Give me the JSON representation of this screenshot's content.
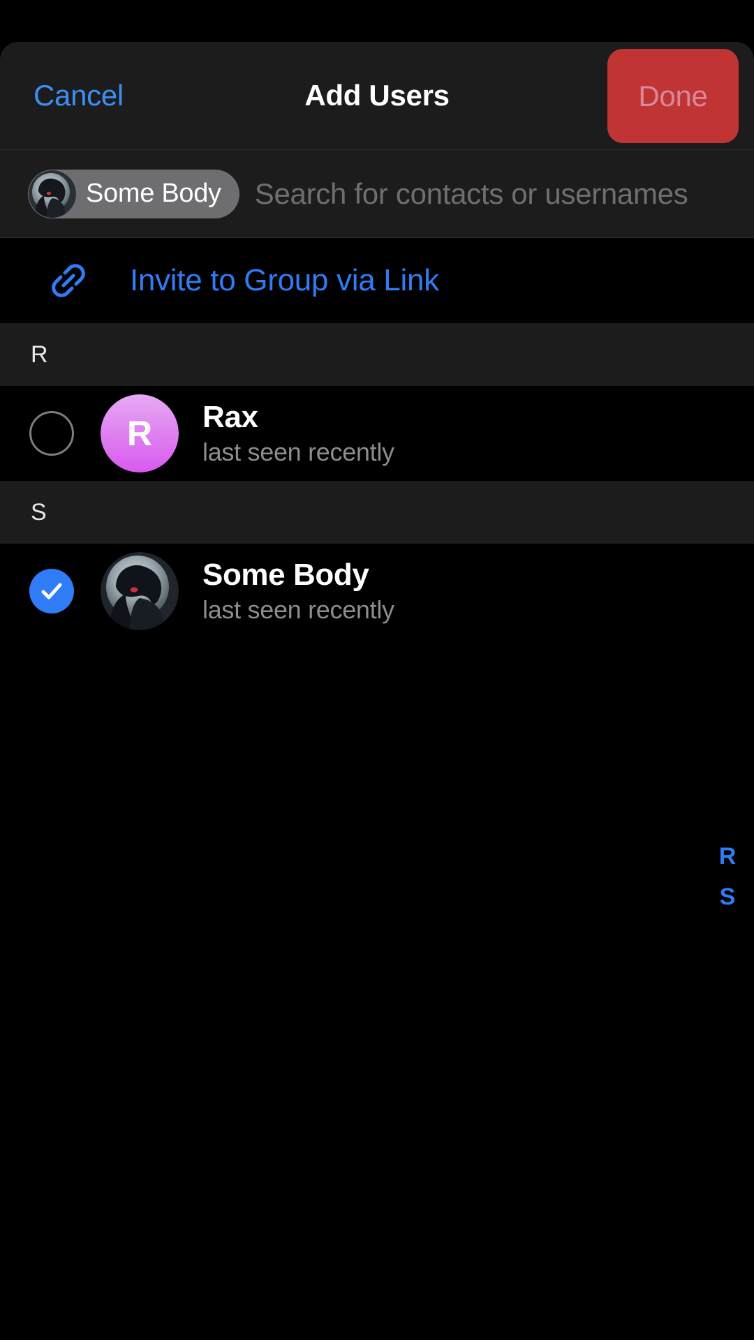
{
  "navbar": {
    "cancel_label": "Cancel",
    "title": "Add Users",
    "done_label": "Done",
    "done_bg_color": "#c03434",
    "done_text_color": "#d9889a",
    "cancel_color": "#3e8ef7"
  },
  "search": {
    "token_name": "Some Body",
    "token_avatar": "contact-photo-avatar",
    "placeholder": "Search for contacts or usernames"
  },
  "invite": {
    "icon": "link-icon",
    "label": "Invite to Group via Link",
    "color": "#2f7cf6"
  },
  "sections": [
    {
      "letter": "R",
      "contacts": [
        {
          "name": "Rax",
          "status": "last seen recently",
          "selected": false,
          "avatar_type": "initial",
          "avatar_initial": "R",
          "avatar_color_top": "#e3a6f0",
          "avatar_color_bottom": "#d75df0"
        }
      ]
    },
    {
      "letter": "S",
      "contacts": [
        {
          "name": "Some Body",
          "status": "last seen recently",
          "selected": true,
          "avatar_type": "photo",
          "avatar_initial": "",
          "avatar_color_top": "#9aa6ad",
          "avatar_color_bottom": "#4a5157"
        }
      ]
    }
  ],
  "index_bar": {
    "letters": [
      "R",
      "S"
    ],
    "color": "#2f7cf6"
  },
  "icons": {
    "check": "check-icon",
    "unchecked": "circle-outline-icon"
  }
}
